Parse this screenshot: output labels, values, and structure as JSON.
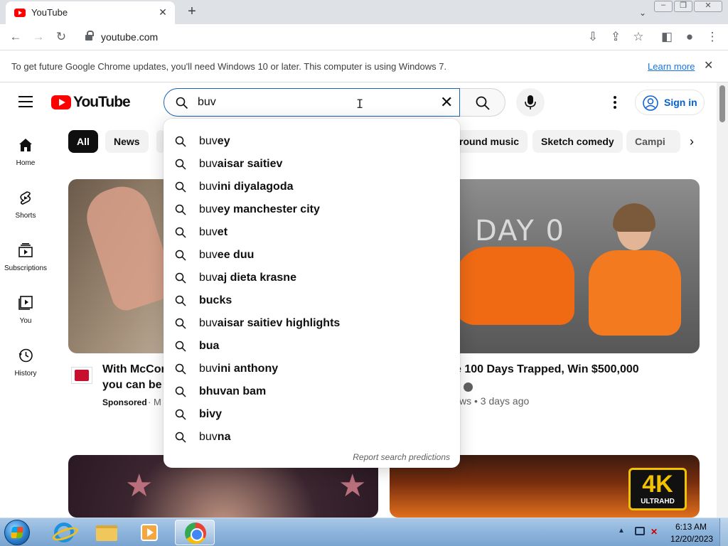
{
  "browser": {
    "tab_title": "YouTube",
    "url": "youtube.com",
    "new_tab_label": "+",
    "tab_close_label": "✕"
  },
  "infobar": {
    "message": "To get future Google Chrome updates, you'll need Windows 10 or later. This computer is using Windows 7.",
    "link": "Learn more",
    "close": "✕"
  },
  "youtube": {
    "logo_text": "YouTube",
    "search": {
      "value": "buv",
      "typed_prefix": "buv",
      "clear_label": "✕"
    },
    "signin_label": "Sign in",
    "guide": [
      {
        "label": "Home",
        "icon": "home-icon"
      },
      {
        "label": "Shorts",
        "icon": "shorts-icon"
      },
      {
        "label": "Subscriptions",
        "icon": "subscriptions-icon"
      },
      {
        "label": "You",
        "icon": "you-icon"
      },
      {
        "label": "History",
        "icon": "history-icon"
      }
    ],
    "chips": [
      "All",
      "News",
      "round music",
      "Sketch comedy",
      "Campi"
    ],
    "suggestions": [
      {
        "typed": "buv",
        "rest": "ey"
      },
      {
        "typed": "buv",
        "rest": "aisar saitiev"
      },
      {
        "typed": "buv",
        "rest": "ini diyalagoda"
      },
      {
        "typed": "buv",
        "rest": "ey manchester city"
      },
      {
        "typed": "buv",
        "rest": "et"
      },
      {
        "typed": "buv",
        "rest": "ee duu"
      },
      {
        "typed": "buv",
        "rest": "aj dieta krasne"
      },
      {
        "typed": "",
        "rest": "bucks"
      },
      {
        "typed": "buv",
        "rest": "aisar saitiev highlights"
      },
      {
        "typed": "",
        "rest": "bua"
      },
      {
        "typed": "buv",
        "rest": "ini anthony"
      },
      {
        "typed": "",
        "rest": "bhuvan bam"
      },
      {
        "typed": "",
        "rest": "bivy"
      },
      {
        "typed": "buv",
        "rest": "na"
      }
    ],
    "report_label": "Report search predictions",
    "videos": [
      {
        "title_line1": "With McCor",
        "title_line2": "you can be s",
        "meta_sponsored": "Sponsored",
        "meta_rest": "· M"
      },
      {
        "title": "e 100 Days Trapped, Win $500,000",
        "channel_fragment": "t",
        "meta": "ws • 3 days ago",
        "wall_text": "DAY 0"
      },
      {},
      {
        "badge_big": "4K",
        "badge_small": "ULTRAHD"
      }
    ]
  },
  "taskbar": {
    "time": "6:13 AM",
    "date": "12/20/2023"
  },
  "colors": {
    "youtube_red": "#ff0000",
    "link_blue": "#065fd4",
    "chip_active": "#0f0f0f",
    "search_focus": "#1c62b9"
  }
}
